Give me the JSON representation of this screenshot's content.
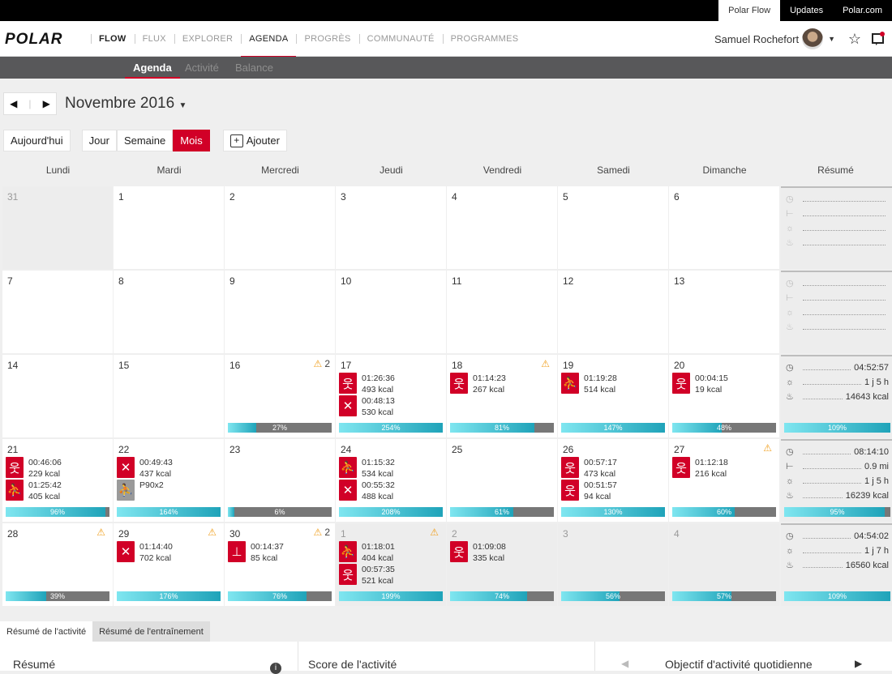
{
  "top_links": [
    "Polar Flow",
    "Updates",
    "Polar.com"
  ],
  "logo": "POLAR",
  "nav": {
    "flow": "FLOW",
    "items": [
      "FLUX",
      "EXPLORER",
      "AGENDA",
      "PROGRÈS",
      "COMMUNAUTÉ",
      "PROGRAMMES"
    ]
  },
  "user": {
    "name": "Samuel Rochefort"
  },
  "subnav": [
    "Agenda",
    "Activité",
    "Balance"
  ],
  "month_label": "Novembre 2016",
  "buttons": {
    "today": "Aujourd'hui",
    "day": "Jour",
    "week": "Semaine",
    "month": "Mois",
    "add": "Ajouter"
  },
  "weekdays": [
    "Lundi",
    "Mardi",
    "Mercredi",
    "Jeudi",
    "Vendredi",
    "Samedi",
    "Dimanche",
    "Résumé"
  ],
  "weeks": [
    {
      "days": [
        {
          "d": "31",
          "grey": true
        },
        {
          "d": "1"
        },
        {
          "d": "2"
        },
        {
          "d": "3"
        },
        {
          "d": "4"
        },
        {
          "d": "5"
        },
        {
          "d": "6"
        }
      ],
      "summary": {
        "rows": [
          [
            "",
            ""
          ],
          [
            "",
            ""
          ],
          [
            "",
            ""
          ],
          [
            "",
            ""
          ]
        ]
      }
    },
    {
      "days": [
        {
          "d": "7"
        },
        {
          "d": "8"
        },
        {
          "d": "9"
        },
        {
          "d": "10"
        },
        {
          "d": "11"
        },
        {
          "d": "12"
        },
        {
          "d": "13"
        }
      ],
      "summary": {
        "rows": [
          [
            "",
            ""
          ],
          [
            "",
            ""
          ],
          [
            "",
            ""
          ],
          [
            "",
            ""
          ]
        ]
      }
    },
    {
      "days": [
        {
          "d": "14"
        },
        {
          "d": "15"
        },
        {
          "d": "16",
          "warn": "2",
          "pct": 27,
          "label": "27%"
        },
        {
          "d": "17",
          "pct": 100,
          "label": "254%",
          "acts": [
            {
              "i": "standing",
              "t": [
                "01:26:36",
                "493 kcal"
              ]
            },
            {
              "i": "group",
              "t": [
                "00:48:13",
                "530 kcal"
              ]
            }
          ]
        },
        {
          "d": "18",
          "warn": "",
          "pct": 81,
          "label": "81%",
          "acts": [
            {
              "i": "running",
              "t": [
                "01:14:23",
                "267 kcal"
              ]
            }
          ]
        },
        {
          "d": "19",
          "pct": 100,
          "label": "147%",
          "acts": [
            {
              "i": "strength",
              "t": [
                "01:19:28",
                "514 kcal"
              ]
            }
          ]
        },
        {
          "d": "20",
          "pct": 48,
          "label": "48%",
          "acts": [
            {
              "i": "standing",
              "t": [
                "00:04:15",
                "19 kcal"
              ]
            }
          ]
        }
      ],
      "summary": {
        "rows": [
          [
            "stopwatch",
            "04:52:57"
          ],
          [
            "sun",
            "1 j 5 h"
          ],
          [
            "flame",
            "14643 kcal"
          ]
        ],
        "pct": 100,
        "label": "109%"
      }
    },
    {
      "days": [
        {
          "d": "21",
          "pct": 96,
          "label": "96%",
          "acts": [
            {
              "i": "walking",
              "t": [
                "00:46:06",
                "229 kcal"
              ]
            },
            {
              "i": "strength",
              "t": [
                "01:25:42",
                "405 kcal"
              ]
            }
          ]
        },
        {
          "d": "22",
          "pct": 100,
          "label": "164%",
          "acts": [
            {
              "i": "group",
              "t": [
                "00:49:43",
                "437 kcal"
              ]
            },
            {
              "i": "strength-grey",
              "t": [
                "P90x2"
              ]
            }
          ]
        },
        {
          "d": "23",
          "pct": 6,
          "label": "6%"
        },
        {
          "d": "24",
          "pct": 100,
          "label": "208%",
          "acts": [
            {
              "i": "strength",
              "t": [
                "01:15:32",
                "534 kcal"
              ]
            },
            {
              "i": "group",
              "t": [
                "00:55:32",
                "488 kcal"
              ]
            }
          ]
        },
        {
          "d": "25",
          "pct": 61,
          "label": "61%"
        },
        {
          "d": "26",
          "pct": 100,
          "label": "130%",
          "acts": [
            {
              "i": "standing",
              "t": [
                "00:57:17",
                "473 kcal"
              ]
            },
            {
              "i": "standing",
              "t": [
                "00:51:57",
                "94 kcal"
              ]
            }
          ]
        },
        {
          "d": "27",
          "warn": "",
          "pct": 60,
          "label": "60%",
          "acts": [
            {
              "i": "hiking",
              "t": [
                "01:12:18",
                "216 kcal"
              ]
            }
          ]
        }
      ],
      "summary": {
        "rows": [
          [
            "stopwatch",
            "08:14:10"
          ],
          [
            "distance",
            "0.9 mi"
          ],
          [
            "sun",
            "1 j 5 h"
          ],
          [
            "flame",
            "16239 kcal"
          ]
        ],
        "pct": 95,
        "label": "95%"
      }
    },
    {
      "days": [
        {
          "d": "28",
          "warn": "",
          "pct": 39,
          "label": "39%"
        },
        {
          "d": "29",
          "warn": "",
          "pct": 100,
          "label": "176%",
          "acts": [
            {
              "i": "group",
              "t": [
                "01:14:40",
                "702 kcal"
              ]
            }
          ]
        },
        {
          "d": "30",
          "warn": "2",
          "pct": 76,
          "label": "76%",
          "acts": [
            {
              "i": "weights",
              "t": [
                "00:14:37",
                "85 kcal"
              ]
            }
          ]
        },
        {
          "d": "1",
          "grey": true,
          "warn": "",
          "pct": 100,
          "label": "199%",
          "acts": [
            {
              "i": "strength",
              "t": [
                "01:18:01",
                "404 kcal"
              ]
            },
            {
              "i": "standing",
              "t": [
                "00:57:35",
                "521 kcal"
              ]
            }
          ]
        },
        {
          "d": "2",
          "grey": true,
          "pct": 74,
          "label": "74%",
          "acts": [
            {
              "i": "standing",
              "t": [
                "01:09:08",
                "335 kcal"
              ]
            }
          ]
        },
        {
          "d": "3",
          "grey": true,
          "pct": 56,
          "label": "56%"
        },
        {
          "d": "4",
          "grey": true,
          "pct": 57,
          "label": "57%"
        }
      ],
      "summary": {
        "rows": [
          [
            "stopwatch",
            "04:54:02"
          ],
          [
            "sun",
            "1 j 7 h"
          ],
          [
            "flame",
            "16560 kcal"
          ]
        ],
        "pct": 100,
        "label": "109%"
      }
    }
  ],
  "bottom_tabs": [
    "Résumé de l'activité",
    "Résumé de l'entraînement"
  ],
  "bottom_panels": {
    "summary": "Résumé",
    "score": "Score de l'activité",
    "goal": "Objectif d'activité quotidienne"
  }
}
